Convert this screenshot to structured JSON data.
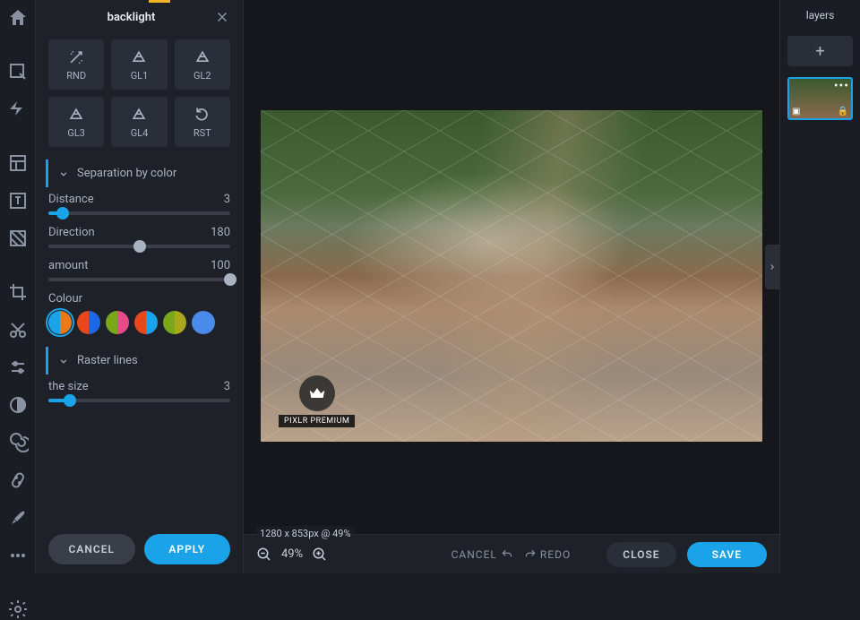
{
  "panel": {
    "title": "backlight",
    "presets": [
      {
        "label": "RND",
        "icon": "wand"
      },
      {
        "label": "GL1",
        "icon": "prism"
      },
      {
        "label": "GL2",
        "icon": "prism"
      },
      {
        "label": "GL3",
        "icon": "prism"
      },
      {
        "label": "GL4",
        "icon": "prism"
      },
      {
        "label": "RST",
        "icon": "reset"
      }
    ],
    "section1": "Separation by color",
    "params": {
      "distance": {
        "label": "Distance",
        "value": "3",
        "pct": 8
      },
      "direction": {
        "label": "Direction",
        "value": "180",
        "pct": 50
      },
      "amount": {
        "label": "amount",
        "value": "100",
        "pct": 100
      }
    },
    "colour_label": "Colour",
    "swatches": [
      "#1aa3e8/#e87a1a",
      "#e8481a/#1a6ae8",
      "#7aa81a/#e84a8a",
      "#e8481a/#1aa3e8",
      "#7aa81a/#a8a81a",
      "#4a8ae8/#4a8ae8"
    ],
    "section2": "Raster lines",
    "size": {
      "label": "the size",
      "value": "3",
      "pct": 12
    },
    "cancel": "CANCEL",
    "apply": "APPLY"
  },
  "canvas": {
    "status": "1280 x 853px @ 49%",
    "premium": "PIXLR PREMIUM"
  },
  "bottom": {
    "zoom": "49%",
    "cancel": "CANCEL",
    "redo": "REDO",
    "close": "CLOSE",
    "save": "SAVE"
  },
  "layers": {
    "title": "layers"
  }
}
